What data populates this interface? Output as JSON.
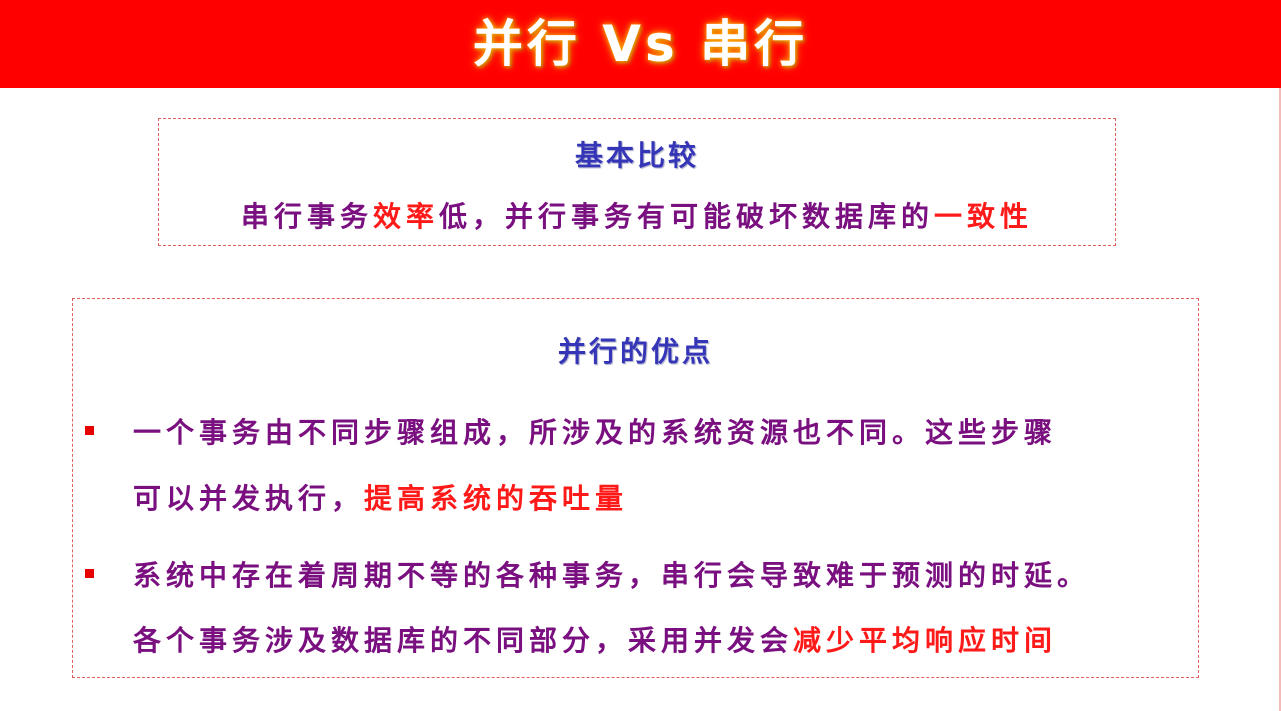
{
  "header": {
    "title": "并行 Vs 串行"
  },
  "comparison": {
    "heading": "基本比较",
    "line": {
      "part1": "串行事务",
      "highlight1": "效率",
      "part2": "低，并行事务有可能破坏数据库的",
      "highlight2": "一致性"
    }
  },
  "advantages": {
    "heading": "并行的优点",
    "items": [
      {
        "line1": "一个事务由不同步骤组成，所涉及的系统资源也不同。这些步骤",
        "line2_text": "可以并发执行，",
        "line2_highlight": "提高系统的吞吐量"
      },
      {
        "line1": "系统中存在着周期不等的各种事务，串行会导致难于预测的时延。",
        "line2_text": "各个事务涉及数据库的不同部分，采用并发会",
        "line2_highlight": "减少平均响应时间"
      }
    ]
  },
  "colors": {
    "header_bg": "#ff0000",
    "heading_text": "#3535b8",
    "body_text": "#7a1080",
    "highlight": "#ff1a1a"
  }
}
